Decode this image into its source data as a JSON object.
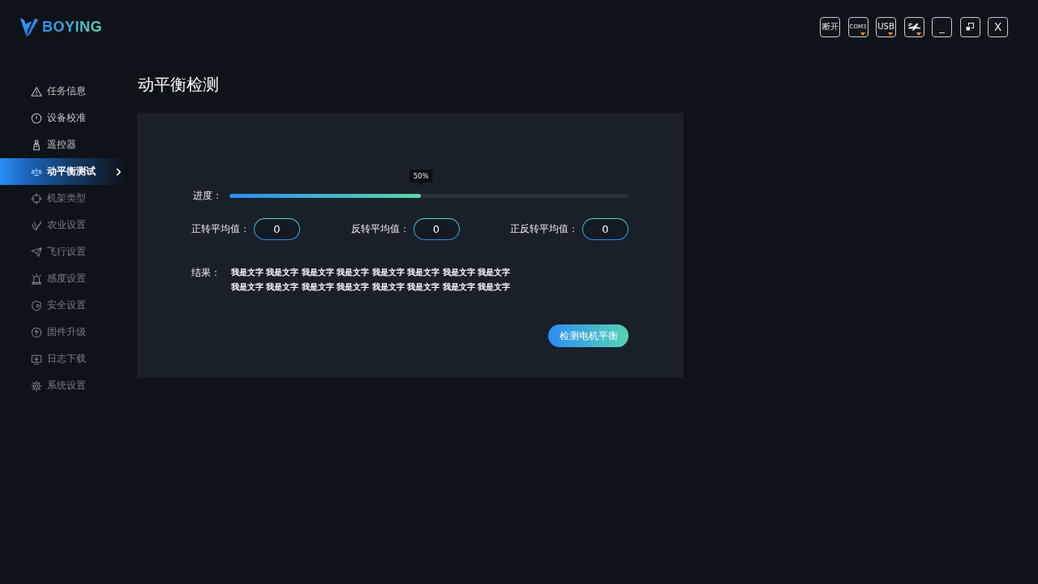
{
  "header": {
    "logo": "BOYING",
    "buttons": [
      {
        "kind": "text",
        "label": "断开",
        "dropdown": false
      },
      {
        "kind": "text",
        "label": "COM3",
        "dropdown": true
      },
      {
        "kind": "text",
        "label": "USB",
        "dropdown": true
      },
      {
        "kind": "icon",
        "dropdown": true
      },
      {
        "kind": "text",
        "label": "_",
        "dropdown": false
      },
      {
        "kind": "icon",
        "dropdown": false
      },
      {
        "kind": "text",
        "label": "X",
        "dropdown": false
      }
    ]
  },
  "sidebar": {
    "items": [
      {
        "label": "任务信息",
        "selected": false,
        "disabled": false
      },
      {
        "label": "设备校准",
        "selected": false,
        "disabled": false
      },
      {
        "label": "遥控器",
        "selected": false,
        "disabled": false
      },
      {
        "label": "动平衡测试",
        "selected": true,
        "disabled": false
      },
      {
        "label": "机架类型",
        "selected": false,
        "disabled": true
      },
      {
        "label": "农业设置",
        "selected": false,
        "disabled": true
      },
      {
        "label": "飞行设置",
        "selected": false,
        "disabled": true
      },
      {
        "label": "感度设置",
        "selected": false,
        "disabled": true
      },
      {
        "label": "安全设置",
        "selected": false,
        "disabled": true
      },
      {
        "label": "固件升级",
        "selected": false,
        "disabled": true
      },
      {
        "label": "日志下载",
        "selected": false,
        "disabled": true
      },
      {
        "label": "系统设置",
        "selected": false,
        "disabled": true
      }
    ]
  },
  "page": {
    "title": "动平衡检测"
  },
  "panel": {
    "progress": {
      "label": "进度：",
      "level": 0.48,
      "tooltip": "50%"
    },
    "averages": [
      {
        "label": "正转平均值：",
        "value": "0"
      },
      {
        "label": "反转平均值：",
        "value": "0"
      },
      {
        "label": "正反转平均值：",
        "value": "0"
      }
    ],
    "result": {
      "label": "结果：",
      "lines": [
        "我是文字 我是文字 我是文字 我是文字 我是文字 我是文字 我是文字 我是文字",
        "我是文字 我是文字 我是文字 我是文字 我是文字 我是文字 我是文字 我是文字"
      ]
    },
    "action_button": "检测电机平衡"
  }
}
